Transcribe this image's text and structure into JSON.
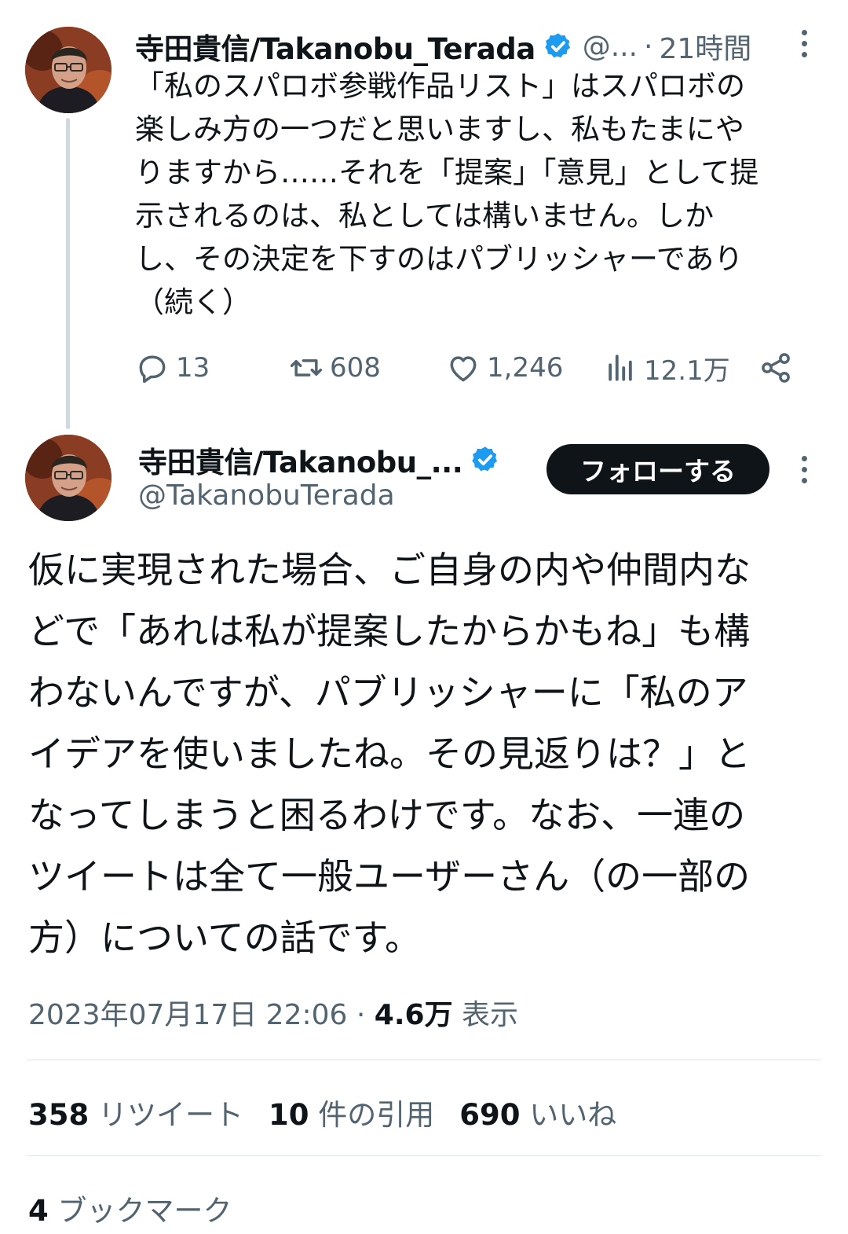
{
  "colors": {
    "text_primary": "#0f1419",
    "text_secondary": "#536471",
    "verified_blue": "#1d9bf0",
    "follow_button_bg": "#0f1419"
  },
  "tweet1": {
    "author_name": "寺田貴信/Takanobu_Terada",
    "handle_truncated": "@...",
    "separator": "·",
    "time_ago": "21時間",
    "text": "「私のスパロボ参戦作品リスト」はスパロボの\n楽しみ方の一つだと思いますし、私もたまにや\nりますから……それを「提案」「意見」として提\n示されるのは、私としては構いません。しか\nし、その決定を下すのはパブリッシャーであり\n（続く）",
    "replies": "13",
    "retweets": "608",
    "likes": "1,246",
    "views": "12.1万"
  },
  "tweet2": {
    "author_name": "寺田貴信/Takanobu_...",
    "handle": "@TakanobuTerada",
    "follow_label": "フォローする",
    "text": "仮に実現された場合、ご自身の内や仲間内な\nどで「あれは私が提案したからかもね」も構\nわないんですが、パブリッシャーに「私のア\nイデアを使いましたね。その見返りは？」と\nなってしまうと困るわけです。なお、一連の\nツイートは全て一般ユーザーさん（の一部の\n方）についての話です。",
    "timestamp": "2023年07月17日 22:06",
    "separator": "·",
    "view_count": "4.6万",
    "view_label": "表示",
    "retweet_count": "358",
    "retweet_label": "リツイート",
    "quote_count": "10",
    "quote_label": "件の引用",
    "like_count": "690",
    "like_label": "いいね",
    "bookmark_count": "4",
    "bookmark_label": "ブックマーク"
  },
  "icons": {
    "avatar": "avatar-photo",
    "verified": "verified-badge-icon",
    "more": "more-vertical-icon",
    "reply": "reply-icon",
    "retweet": "retweet-icon",
    "like": "heart-icon",
    "views": "bar-chart-icon",
    "share": "share-icon"
  }
}
